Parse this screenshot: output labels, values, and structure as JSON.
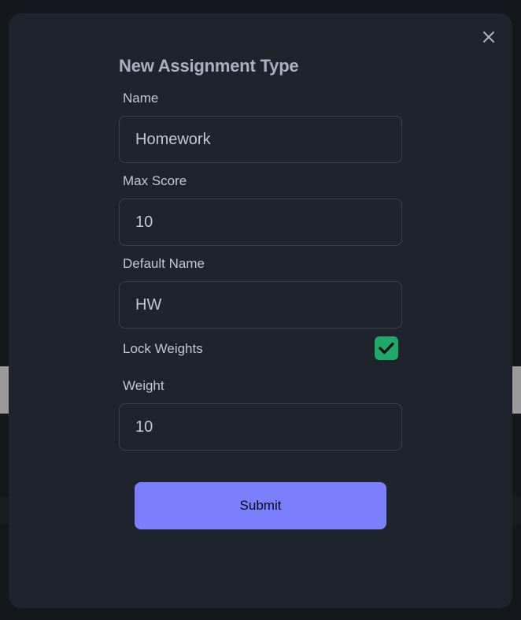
{
  "modal": {
    "title": "New Assignment Type",
    "close_icon": "close-icon"
  },
  "form": {
    "name": {
      "label": "Name",
      "value": "Homework"
    },
    "max_score": {
      "label": "Max Score",
      "value": "10"
    },
    "default_name": {
      "label": "Default Name",
      "value": "HW"
    },
    "lock_weights": {
      "label": "Lock Weights",
      "checked": true,
      "icon": "checkmark-icon"
    },
    "weight": {
      "label": "Weight",
      "value": "10"
    },
    "submit_label": "Submit"
  },
  "colors": {
    "modal_bg": "#1f232b",
    "accent": "#7b7ffe",
    "checkbox": "#1ea86a",
    "title": "#a9b2c1",
    "label": "#c3c8d0",
    "border": "#3b4150"
  }
}
